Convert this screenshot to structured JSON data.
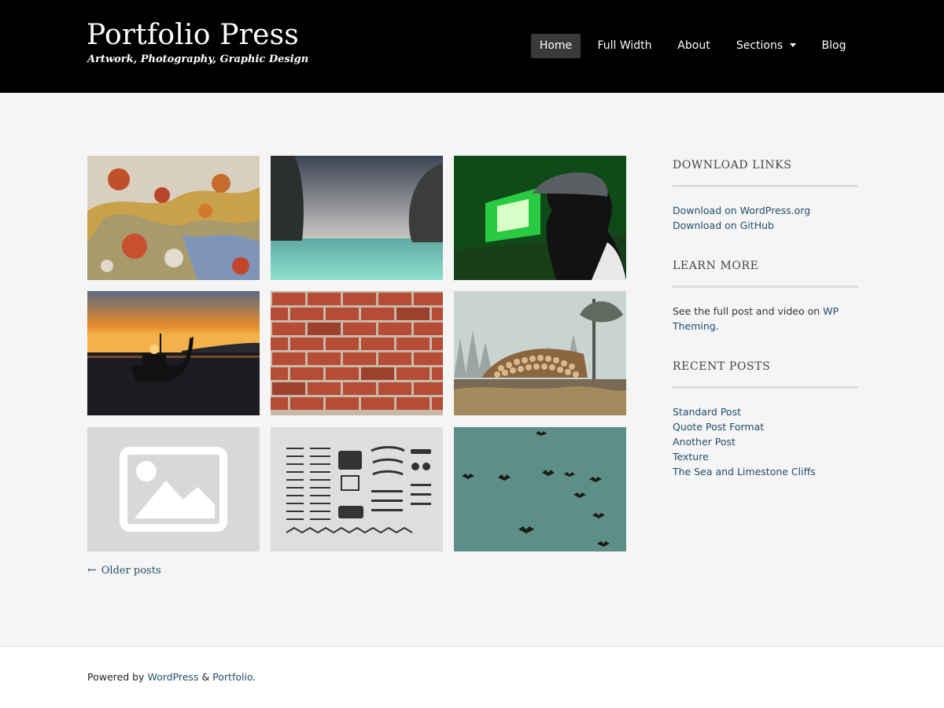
{
  "header": {
    "site_title": "Portfolio Press",
    "tagline": "Artwork, Photography, Graphic Design",
    "nav": [
      {
        "label": "Home"
      },
      {
        "label": "Full Width"
      },
      {
        "label": "About"
      },
      {
        "label": "Sections"
      },
      {
        "label": "Blog"
      }
    ]
  },
  "gallery": {
    "tiles": [
      {
        "subject": "peeling paint texture"
      },
      {
        "subject": "sea and limestone cliffs"
      },
      {
        "subject": "person in green lit room"
      },
      {
        "subject": "longtail boat at sunset"
      },
      {
        "subject": "red brick wall"
      },
      {
        "subject": "log pile in misty forest"
      },
      {
        "subject": "image placeholder"
      },
      {
        "subject": "typewriter parts flat lay"
      },
      {
        "subject": "birds flying in teal sky"
      }
    ],
    "older_posts": "Older posts"
  },
  "sidebar": {
    "download": {
      "title": "DOWNLOAD LINKS",
      "links": [
        "Download on WordPress.org",
        "Download on GitHub"
      ]
    },
    "learn": {
      "title": "LEARN MORE",
      "text": "See the full post and video on ",
      "link": "WP Theming",
      "text_end": "."
    },
    "recent": {
      "title": "RECENT POSTS",
      "links": [
        "Standard Post",
        "Quote Post Format",
        "Another Post",
        "Texture",
        "The Sea and Limestone Cliffs"
      ]
    }
  },
  "footer": {
    "prefix": "Powered by ",
    "link1": "WordPress",
    "amp": " & ",
    "link2": "Portfolio",
    "suffix": "."
  },
  "colors": {
    "header_bg": "#000000",
    "page_bg": "#f5f5f5",
    "link": "#1f4e6c",
    "nav_active_bg": "#3a3a3a"
  },
  "icons": {
    "nav_dropdown": "caret-down-icon",
    "older_posts": "arrow-left-icon",
    "placeholder": "image-placeholder-icon"
  }
}
